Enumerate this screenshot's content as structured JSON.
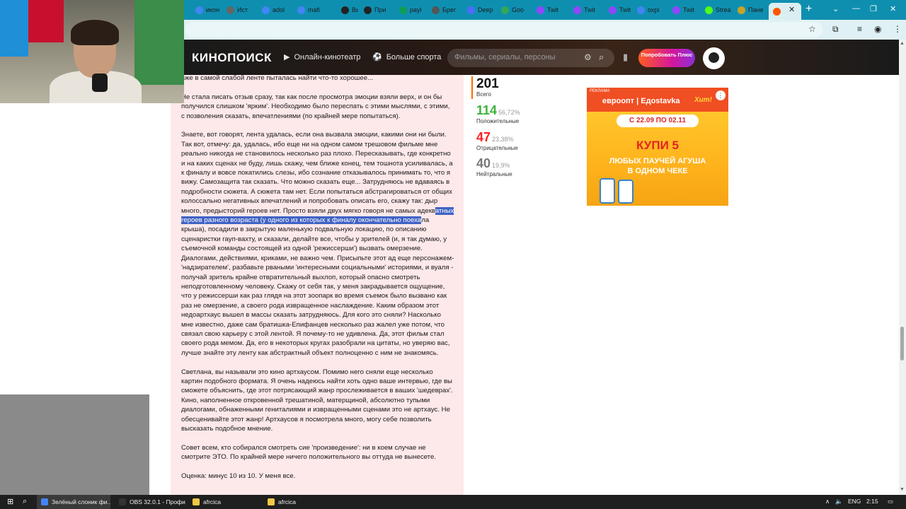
{
  "browser": {
    "tabs": [
      {
        "label": "икон",
        "fav_color": "#4285f4"
      },
      {
        "label": "Ист",
        "fav_color": "#666666"
      },
      {
        "label": "adol",
        "fav_color": "#4285f4"
      },
      {
        "label": "mafi",
        "fav_color": "#4285f4"
      },
      {
        "label": "Выш",
        "fav_color": "#222222"
      },
      {
        "label": "При",
        "fav_color": "#222222"
      },
      {
        "label": "payl",
        "fav_color": "#0f9d58"
      },
      {
        "label": "Брег",
        "fav_color": "#555555"
      },
      {
        "label": "Deep",
        "fav_color": "#4d6bfe"
      },
      {
        "label": "Goo",
        "fav_color": "#34a853"
      },
      {
        "label": "Twit",
        "fav_color": "#9146ff"
      },
      {
        "label": "Twit",
        "fav_color": "#9146ff"
      },
      {
        "label": "Twit",
        "fav_color": "#9146ff"
      },
      {
        "label": "oxpi",
        "fav_color": "#4285f4"
      },
      {
        "label": "Twit",
        "fav_color": "#9146ff"
      },
      {
        "label": "Strea",
        "fav_color": "#53fc18"
      },
      {
        "label": "Пане",
        "fav_color": "#c9a227"
      },
      {
        "label": "",
        "fav_color": "#ff5500"
      }
    ],
    "new_tab_glyph": "+",
    "close_glyph": "✕",
    "window_controls": [
      "⌄",
      "—",
      "❐",
      "✕"
    ],
    "toolbar_icons": [
      "☆",
      "⧉",
      "≡",
      "◉",
      "⋮"
    ]
  },
  "kinopoisk": {
    "logo": "КИНОПОИСК",
    "nav": [
      {
        "label": "Онлайн-кинотеатр",
        "icon": "play-icon",
        "glyph": "▶"
      },
      {
        "label": "Больше спорта",
        "icon": "sport-icon",
        "glyph": "⚽"
      }
    ],
    "search_placeholder": "Фильмы, сериалы, персоны",
    "filter_glyph": "⚙",
    "search_glyph": "⌕",
    "bookmark_glyph": "▮",
    "plus_button": "Попробовать Плюс"
  },
  "review": {
    "paragraphs": [
      {
        "pre": "вже в самой слабой ленте пыталась найти что-то хорошее...",
        "hl": "",
        "post": ""
      },
      {
        "pre": "Не стала писать отзыв сразу, так как после просмотра эмоции взяли верх, и он бы получился слишком 'ярким'. Необходимо было переспать с этими мыслями, с этими, с позволения сказать, впечатлениями (по крайней мере попытаться).",
        "hl": "",
        "post": ""
      },
      {
        "pre": "Знаете, вот говорят, лента удалась, если она вызвала эмоции, какими они ни были. Так вот, отмечу: да, удалась, ибо еще ни на одном самом трешовом фильме мне реально никогда не становилось несколько раз плохо. Пересказывать, где конкретно и на каких сценах не буду, лишь скажу, чем ближе конец, тем тошнота усиливалась, а к финалу и вовсе покатились слезы, ибо сознание отказывалось принимать то, что я вижу. Самозащита так сказать. Что можно сказать еще... Затрудняюсь не вдаваясь в подробности сюжета. А сюжета там нет. Если попытаться абстрагироваться от общих колоссально негативных впечатлений и попробовать описать его, скажу так: дыр много, предысторий героев нет. Просто взяли двух мягко говоря не самых адекв",
        "hl": "атных героев разного возраста (у одного из которых к финалу окончательно поеха",
        "post": "ла крыша), посадили в закрытую маленькую подвальную локацию, по описанию сценаристки гауп-вахту, и сказали, делайте все, чтобы у зрителей (и, я так думаю, у съемочной команды состоящей из одной 'режиссерши') вызвать омерзение. Диалогами, действиями, криками, не важно чем. Присыпьте этот ад еще персонажем-'надзирателем', разбавьте рваными 'интересными социальными' историями, и вуаля - получай зритель крайне отвратительный выхлоп, который опасно смотреть неподготовленному человеку. Скажу от себя так, у меня закрадывается ощущение, что у режиссерши как раз глядя на этот зоопарк во время съемок было вызвано как раз не омерзение, а своего рода извращенное наслаждение. Каким образом этот недоартхаус вышел в массы сказать затрудняюсь. Для кого это сняли? Насколько мне известно, даже сам братишка-Епифанцев несколько раз жалел уже потом, что связал свою карьеру с этой лентой. Я почему-то не удивлена. Да, этот фильм стал своего рода мемом. Да, его в некоторых кругах разобрали на цитаты, но уверяю вас, лучше знайте эту ленту как абстрактный объект полноценно с ним не знакомясь."
      },
      {
        "pre": "Светлана, вы называли это кино артхаусом. Помимо него сняли еще несколько картин подобного формата. Я очень надеюсь найти хоть одно ваше интервью, где вы сможете объяснить, где этот потрясающий жанр прослеживается в ваших 'шедеврах'. Кино, наполненное откровенной трешатиной, матерщиной, абсолютно тупыми диалогами, обнаженными гениталиями и извращенными сценами это не артхаус. Не обесценивайте этот жанр! Артхаусов я посмотрела много, могу себе позволить высказать подобное мнение.",
        "hl": "",
        "post": ""
      },
      {
        "pre": "Совет всем, кто собирался смотреть сие 'произведение': ни в коем случае не смотрите ЭТО. По крайней мере ничего положительного вы оттуда не вынесете.",
        "hl": "",
        "post": ""
      },
      {
        "pre": "Оценка: минус 10 из 10. У меня все.",
        "hl": "",
        "post": ""
      }
    ]
  },
  "stats": {
    "total": {
      "value": "201",
      "label": "Всего"
    },
    "positive": {
      "value": "114",
      "pct": "56,72%",
      "label": "Положительные",
      "color": "#3bb33b"
    },
    "negative": {
      "value": "47",
      "pct": "23,38%",
      "label": "Отрицательные",
      "color": "#ff1f1f"
    },
    "neutral": {
      "value": "40",
      "pct": "19,9%",
      "label": "Нейтральные",
      "color": "#777777"
    }
  },
  "ad": {
    "label": "РЕКЛАМА",
    "brands": "евроопт | Едоstavka",
    "hit": "Хит!",
    "menu_glyph": "⋮",
    "date": "С 22.09 ПО 02.11",
    "big": "КУПИ 5",
    "sub1": "ЛЮБЫХ ПАУЧЕЙ АГУША",
    "sub2": "В ОДНОМ ЧЕКЕ"
  },
  "taskbar": {
    "start_glyph": "⊞",
    "search_glyph": "⌕",
    "items": [
      {
        "label": "Зелёный слоник фи...",
        "color": "#4285f4",
        "active": true
      },
      {
        "label": "OBS 32.0.1 - Профил...",
        "color": "#333333",
        "active": false
      },
      {
        "label": "afrcica",
        "color": "#f2c744",
        "active": false
      },
      {
        "label": "afrcica",
        "color": "#f2c744",
        "active": false
      }
    ],
    "tray": {
      "chevron": "∧",
      "speaker": "🔈",
      "lang": "ENG",
      "time": "2:15",
      "notif": "▭"
    }
  }
}
